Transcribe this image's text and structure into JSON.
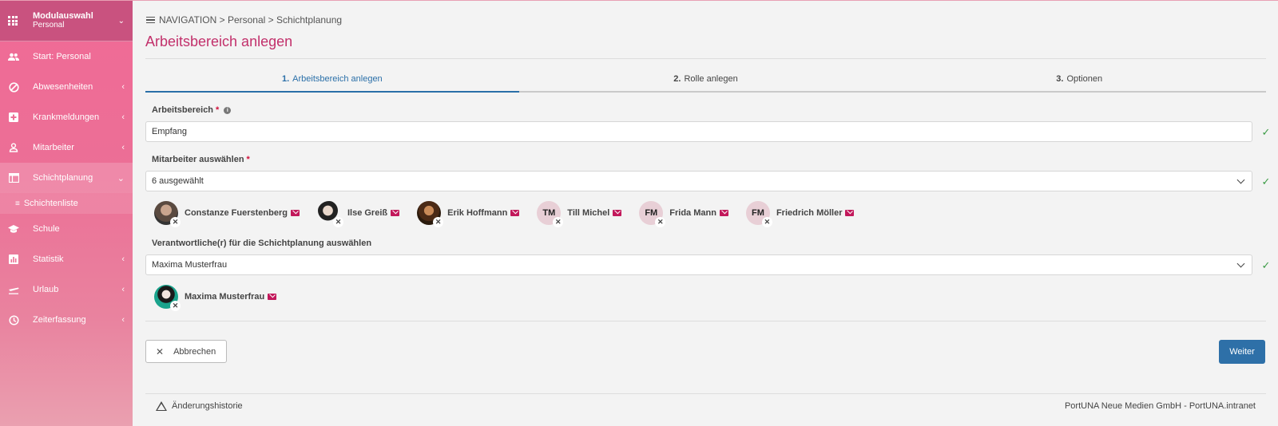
{
  "sidebar": {
    "module_title": "Modulauswahl",
    "module_subtitle": "Personal",
    "items": [
      {
        "label": "Start: Personal",
        "icon": "people-icon"
      },
      {
        "label": "Abwesenheiten",
        "icon": "block-icon"
      },
      {
        "label": "Krankmeldungen",
        "icon": "medical-plus-icon"
      },
      {
        "label": "Mitarbeiter",
        "icon": "person-icon"
      },
      {
        "label": "Schichtplanung",
        "icon": "table-icon"
      },
      {
        "label": "Schule",
        "icon": "graduation-cap-icon"
      },
      {
        "label": "Statistik",
        "icon": "bar-chart-icon"
      },
      {
        "label": "Urlaub",
        "icon": "airplane-icon"
      },
      {
        "label": "Zeiterfassung",
        "icon": "clock-icon"
      }
    ],
    "sub_item": "Schichtenliste"
  },
  "breadcrumb": {
    "root": "NAVIGATION",
    "sep": ">",
    "level1": "Personal",
    "level2": "Schichtplanung"
  },
  "page_title": "Arbeitsbereich anlegen",
  "steps": [
    {
      "num": "1.",
      "label": "Arbeitsbereich anlegen"
    },
    {
      "num": "2.",
      "label": "Rolle anlegen"
    },
    {
      "num": "3.",
      "label": "Optionen"
    }
  ],
  "form": {
    "area_label": "Arbeitsbereich",
    "area_value": "Empfang",
    "employees_label": "Mitarbeiter auswählen",
    "employees_value": "6 ausgewählt",
    "responsible_label": "Verantwortliche(r) für die Schichtplanung auswählen",
    "responsible_value": "Maxima Musterfrau",
    "required_mark": "*",
    "info_mark": "i",
    "check_mark": "✓"
  },
  "employees": [
    {
      "name": "Constanze Fuerstenberg",
      "initials": ""
    },
    {
      "name": "Ilse Greiß",
      "initials": ""
    },
    {
      "name": "Erik Hoffmann",
      "initials": ""
    },
    {
      "name": "Till Michel",
      "initials": "TM"
    },
    {
      "name": "Frida Mann",
      "initials": "FM"
    },
    {
      "name": "Friedrich Möller",
      "initials": "FM"
    }
  ],
  "responsible": [
    {
      "name": "Maxima Musterfrau",
      "initials": ""
    }
  ],
  "buttons": {
    "cancel": "Abbrechen",
    "next": "Weiter"
  },
  "footer": {
    "history": "Änderungshistorie",
    "company": "PortUNA Neue Medien GmbH - PortUNA.intranet"
  },
  "colors": {
    "accent": "#c2306b",
    "primary_button": "#2e70a8",
    "sidebar_start": "#f06a96",
    "check": "#3b9b45"
  }
}
